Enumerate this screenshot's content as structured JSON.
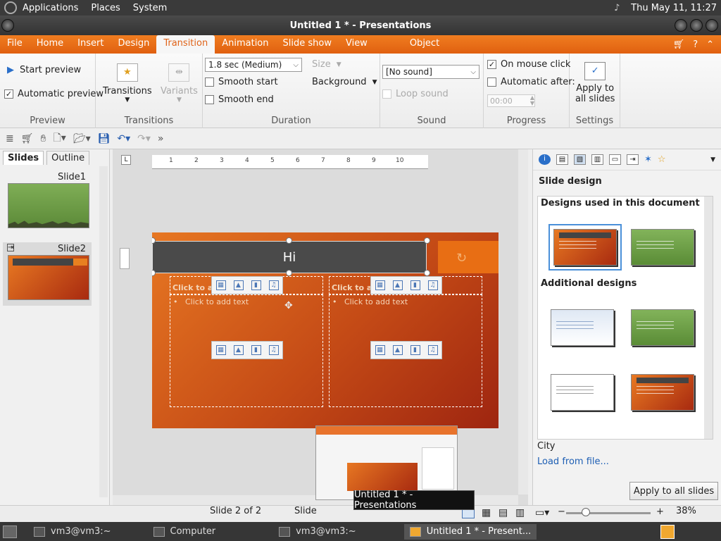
{
  "top_panel": {
    "menus": [
      "Applications",
      "Places",
      "System"
    ],
    "clock": "Thu May 11, 11:27"
  },
  "window": {
    "title": "Untitled 1 * - Presentations"
  },
  "ribbon_tabs": [
    "File",
    "Home",
    "Insert",
    "Design",
    "Transition",
    "Animation",
    "Slide show",
    "View"
  ],
  "ribbon_object_tab": "Object",
  "ribbon": {
    "preview": {
      "start_label": "Start preview",
      "auto_label": "Automatic preview",
      "title": "Preview"
    },
    "transitions": {
      "transitions_label": "Transitions",
      "variants_label": "Variants",
      "title": "Transitions"
    },
    "duration": {
      "value": "1.8 sec (Medium)",
      "size_label": "Size",
      "smooth_start": "Smooth start",
      "smooth_end": "Smooth end",
      "background_label": "Background",
      "title": "Duration"
    },
    "sound": {
      "value": "[No sound]",
      "loop_label": "Loop sound",
      "title": "Sound"
    },
    "progress": {
      "mouse_label": "On mouse click",
      "auto_label": "Automatic after:",
      "time_value": "00:00",
      "title": "Progress"
    },
    "settings": {
      "apply_line1": "Apply to",
      "apply_line2": "all slides",
      "title": "Settings"
    }
  },
  "slides_pane": {
    "tabs": [
      "Slides",
      "Outline"
    ],
    "slides": [
      "Slide1",
      "Slide2"
    ]
  },
  "slide": {
    "title": "Hi",
    "placeholder_title": "Click to add",
    "placeholder_body": "Click to add text"
  },
  "ruler": {
    "marks": [
      "1",
      "2",
      "3",
      "4",
      "5",
      "6",
      "7",
      "8",
      "9",
      "10"
    ]
  },
  "sidebar": {
    "title": "Slide design",
    "used_heading": "Designs used in this document",
    "additional_heading": "Additional designs",
    "design_label": "City",
    "load_link": "Load from file...",
    "apply_button": "Apply to all slides"
  },
  "status_bar": {
    "slide_info": "Slide 2 of 2",
    "slide_short": "Slide",
    "zoom": "38%"
  },
  "tooltip": "Untitled 1 * - Presentations",
  "taskbar": [
    "vm3@vm3:~",
    "Computer",
    "vm3@vm3:~",
    "Untitled 1 * - Present..."
  ]
}
